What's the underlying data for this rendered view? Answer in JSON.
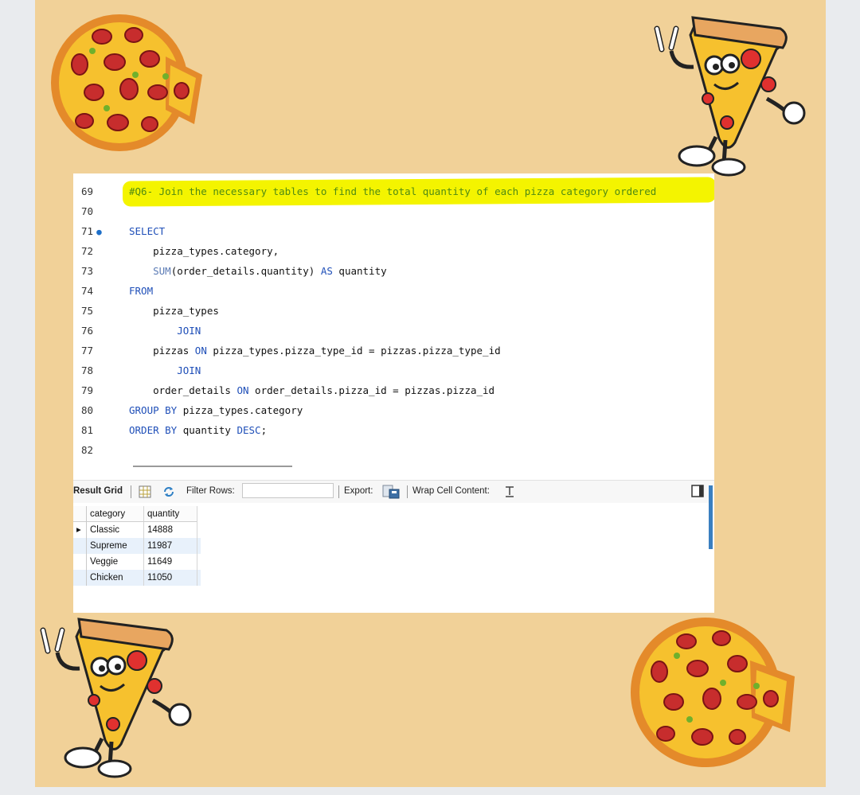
{
  "editor": {
    "lines": [
      {
        "n": "69",
        "tokens": [
          {
            "t": "#Q6- Join the necessary tables to find the total quantity of each pizza category ordered",
            "c": "cmt"
          }
        ]
      },
      {
        "n": "70",
        "tokens": []
      },
      {
        "n": "71",
        "marker": "●",
        "tokens": [
          {
            "t": "SELECT",
            "c": "kw"
          }
        ]
      },
      {
        "n": "72",
        "tokens": [
          {
            "t": "    pizza_types.category,"
          }
        ]
      },
      {
        "n": "73",
        "tokens": [
          {
            "t": "    "
          },
          {
            "t": "SUM",
            "c": "fn"
          },
          {
            "t": "(order_details.quantity) "
          },
          {
            "t": "AS",
            "c": "kw"
          },
          {
            "t": " quantity"
          }
        ]
      },
      {
        "n": "74",
        "tokens": [
          {
            "t": "FROM",
            "c": "kw"
          }
        ]
      },
      {
        "n": "75",
        "tokens": [
          {
            "t": "    pizza_types"
          }
        ]
      },
      {
        "n": "76",
        "tokens": [
          {
            "t": "        "
          },
          {
            "t": "JOIN",
            "c": "kw"
          }
        ]
      },
      {
        "n": "77",
        "tokens": [
          {
            "t": "    pizzas "
          },
          {
            "t": "ON",
            "c": "kw"
          },
          {
            "t": " pizza_types.pizza_type_id = pizzas.pizza_type_id"
          }
        ]
      },
      {
        "n": "78",
        "tokens": [
          {
            "t": "        "
          },
          {
            "t": "JOIN",
            "c": "kw"
          }
        ]
      },
      {
        "n": "79",
        "tokens": [
          {
            "t": "    order_details "
          },
          {
            "t": "ON",
            "c": "kw"
          },
          {
            "t": " order_details.pizza_id = pizzas.pizza_id"
          }
        ]
      },
      {
        "n": "80",
        "tokens": [
          {
            "t": "GROUP BY",
            "c": "kw"
          },
          {
            "t": " pizza_types.category"
          }
        ]
      },
      {
        "n": "81",
        "tokens": [
          {
            "t": "ORDER BY",
            "c": "kw"
          },
          {
            "t": " quantity "
          },
          {
            "t": "DESC",
            "c": "kw"
          },
          {
            "t": ";"
          }
        ]
      },
      {
        "n": "82",
        "tokens": []
      }
    ]
  },
  "toolbar": {
    "result_grid": "Result Grid",
    "filter_rows": "Filter Rows:",
    "filter_value": "",
    "export": "Export:",
    "wrap_cell": "Wrap Cell Content:"
  },
  "grid": {
    "columns": [
      "category",
      "quantity"
    ],
    "rows": [
      {
        "category": "Classic",
        "quantity": "14888"
      },
      {
        "category": "Supreme",
        "quantity": "11987"
      },
      {
        "category": "Veggie",
        "quantity": "11649"
      },
      {
        "category": "Chicken",
        "quantity": "11050"
      }
    ]
  },
  "colors": {
    "background": "#f1d198",
    "keyword": "#1f4fb8",
    "comment": "#4e8a13",
    "highlight": "#f4f400"
  },
  "decorations": [
    "pizza-icon",
    "pizza-mascot-icon",
    "pizza-mascot-icon",
    "pizza-icon"
  ]
}
